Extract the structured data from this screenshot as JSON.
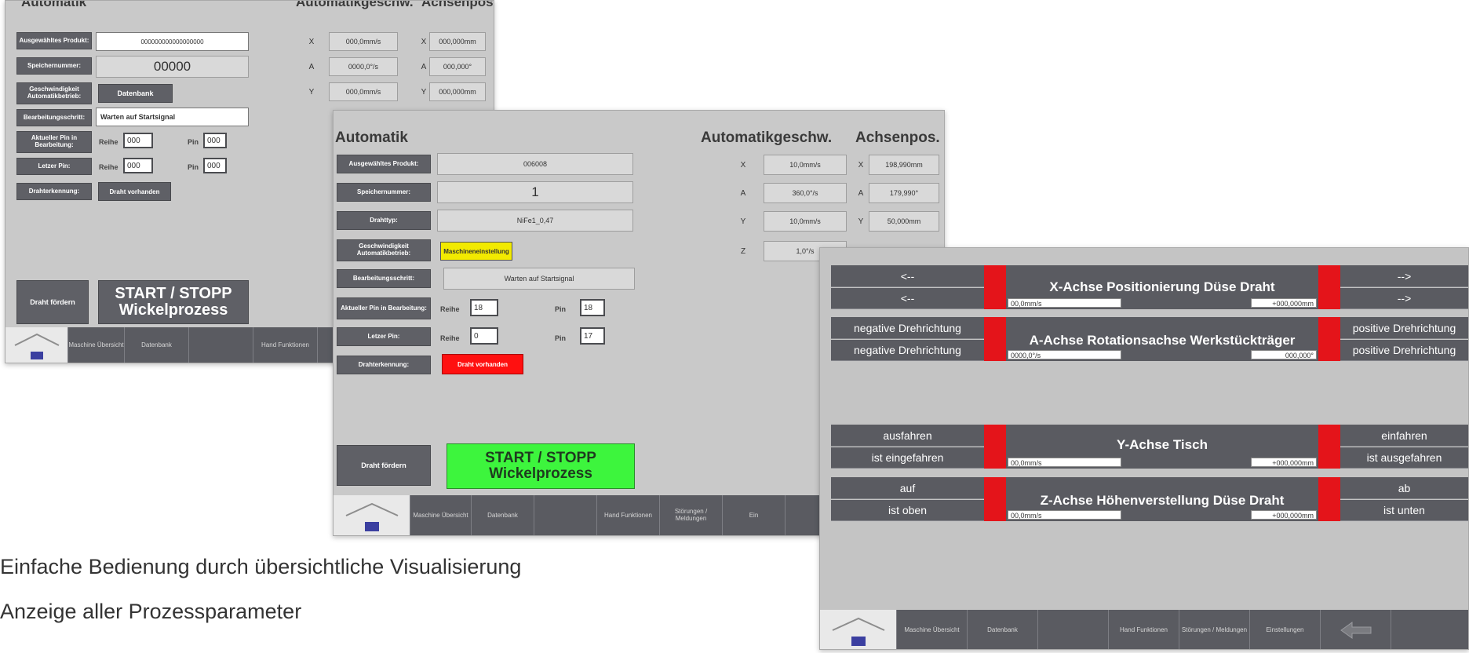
{
  "screen1": {
    "title": "Automatik",
    "col_speed": "Automatikgeschw.",
    "col_pos": "Achsenpos.",
    "labels": {
      "product": "Ausgewähltes Produkt:",
      "memory": "Speichernummer:",
      "speed": "Geschwindigkeit Automatikbetrieb:",
      "step": "Bearbeitungsschritt:",
      "current_pin": "Aktueller Pin in Bearbeitung:",
      "last_pin": "Letzer Pin:",
      "wire_detect": "Drahterkennung:"
    },
    "product_value": "000000000000000000",
    "memory_value": "00000",
    "speed_button": "Datenbank",
    "step_value": "Warten auf Startsignal",
    "reihe_label": "Reihe",
    "pin_label": "Pin",
    "current_reihe": "000",
    "current_pin": "000",
    "last_reihe": "000",
    "last_pin": "000",
    "wire_value": "Draht vorhanden",
    "axes": [
      {
        "axis": "X",
        "speed": "000,0mm/s",
        "pos": "000,000mm"
      },
      {
        "axis": "A",
        "speed": "0000,0°/s",
        "pos": "000,000°"
      },
      {
        "axis": "Y",
        "speed": "000,0mm/s",
        "pos": "000,000mm"
      }
    ],
    "button_wire_feed": "Draht fördern",
    "start_stop": "START / STOPP",
    "start_stop_2": "Wickelprozess",
    "nav": [
      "Maschine Übersicht",
      "Datenbank",
      "",
      "Hand Funktionen"
    ]
  },
  "screen2": {
    "title": "Automatik",
    "col_speed": "Automatikgeschw.",
    "col_pos": "Achsenpos.",
    "labels": {
      "product": "Ausgewähltes Produkt:",
      "memory": "Speichernummer:",
      "wiretype": "Drahttyp:",
      "speed": "Geschwindigkeit Automatikbetrieb:",
      "step": "Bearbeitungsschritt:",
      "current_pin": "Aktueller Pin in Bearbeitung:",
      "last_pin": "Letzer Pin:",
      "wire_detect": "Drahterkennung:"
    },
    "product_value": "006008",
    "memory_value": "1",
    "wiretype_value": "NiFe1_0,47",
    "speed_button": "Maschineneinstellung",
    "step_value": "Warten auf Startsignal",
    "reihe_label": "Reihe",
    "pin_label": "Pin",
    "current_reihe": "18",
    "current_pin": "18",
    "last_reihe": "0",
    "last_pin": "17",
    "wire_value": "Draht vorhanden",
    "axes": [
      {
        "axis": "X",
        "speed": "10,0mm/s",
        "pos": "198,990mm"
      },
      {
        "axis": "A",
        "speed": "360,0°/s",
        "pos": "179,990°"
      },
      {
        "axis": "Y",
        "speed": "10,0mm/s",
        "pos": "50,000mm"
      },
      {
        "axis": "Z",
        "speed": "1,0°/s",
        "pos": ""
      }
    ],
    "button_wire_feed": "Draht fördern",
    "start_stop": "START / STOPP",
    "start_stop_2": "Wickelprozess",
    "nav": [
      "Maschine Übersicht",
      "Datenbank",
      "",
      "Hand Funktionen",
      "Störungen / Meldungen",
      "Ein"
    ],
    "colors": {
      "speed_button": "#f2ea00",
      "wire_value": "#ff1010",
      "start": "#3df53d"
    }
  },
  "screen3": {
    "rows": [
      {
        "left1": "<--",
        "left2": "<--",
        "title": "X-Achse Positionierung Düse Draht",
        "speed": "00,0mm/s",
        "pos": "+000,000mm",
        "right1": "-->",
        "right2": "-->"
      },
      {
        "left1": "negative Drehrichtung",
        "left2": "negative Drehrichtung",
        "title": "A-Achse Rotationsachse Werkstückträger",
        "speed": "0000,0°/s",
        "pos": "000,000°",
        "right1": "positive Drehrichtung",
        "right2": "positive Drehrichtung"
      },
      {
        "left1": "ausfahren",
        "left2": "ist eingefahren",
        "title": "Y-Achse Tisch",
        "speed": "00,0mm/s",
        "pos": "+000,000mm",
        "right1": "einfahren",
        "right2": "ist ausgefahren"
      },
      {
        "left1": "auf",
        "left2": "ist oben",
        "title": "Z-Achse Höhenverstellung Düse Draht",
        "speed": "00,0mm/s",
        "pos": "+000,000mm",
        "right1": "ab",
        "right2": "ist unten"
      }
    ],
    "nav": [
      "Maschine Übersicht",
      "Datenbank",
      "",
      "Hand Funktionen",
      "Störungen / Meldungen",
      "Einstellungen",
      ""
    ]
  },
  "captions": {
    "line1": "Einfache Bedienung durch übersichtliche Visualisierung",
    "line2": "Anzeige aller Prozessparameter"
  },
  "icons": {
    "home": "home-icon",
    "back": "arrow-left-icon"
  }
}
